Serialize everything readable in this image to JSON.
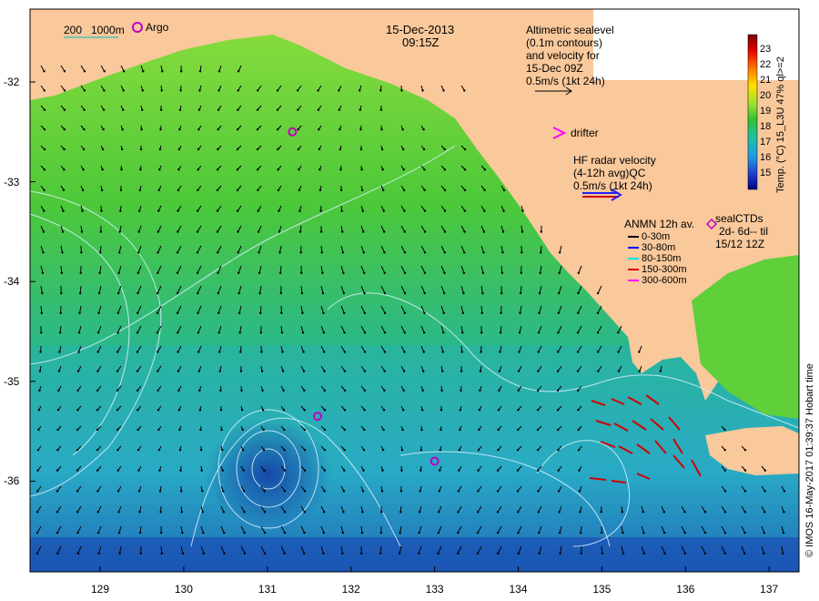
{
  "header": {
    "date": "15-Dec-2013",
    "time": "09:15Z"
  },
  "scale_bar": {
    "labels": [
      "200",
      "1000m"
    ]
  },
  "argo": {
    "label": "Argo"
  },
  "altimetry": {
    "lines": [
      "Altimetric sealevel",
      "(0.1m contours)",
      "and velocity for",
      "15-Dec 09Z",
      "0.5m/s (1kt 24h)"
    ]
  },
  "drifter": {
    "label": "drifter"
  },
  "hf_radar": {
    "lines": [
      "HF radar velocity",
      "(4-12h avg)QC",
      "0.5m/s (1kt 24h)"
    ]
  },
  "anmn": {
    "title": "ANMN 12h av.",
    "entries": [
      {
        "label": "0-30m",
        "color": "#000000"
      },
      {
        "label": "30-80m",
        "color": "#0000ff"
      },
      {
        "label": "80-150m",
        "color": "#00e0e0"
      },
      {
        "label": "150-300m",
        "color": "#d00000"
      },
      {
        "label": "300-600m",
        "color": "#ff00ff"
      }
    ]
  },
  "seal": {
    "lines": [
      "sealCTDs",
      "2d- 6d-- til",
      "15/12 12Z"
    ]
  },
  "colorbar": {
    "ticks": [
      "23",
      "22",
      "21",
      "20",
      "19",
      "18",
      "17",
      "16",
      "15"
    ],
    "title": "Temp. (°C) 15_L3U 47% ql>=2"
  },
  "credit": "© IMOS 16-May-2017 01:39:37 Hobart time",
  "axes": {
    "y_ticks": [
      "-32",
      "-33",
      "-34",
      "-35",
      "-36"
    ],
    "x_ticks": [
      "129",
      "130",
      "131",
      "132",
      "133",
      "134",
      "135",
      "136",
      "137"
    ]
  },
  "colors": {
    "land": "#f9c89b",
    "ocean_warm": "#5fcf3a",
    "ocean_cool": "#2fb8c8",
    "ocean_cold": "#1030a0"
  },
  "argo_floats": [
    {
      "lon": 131.3,
      "lat": -32.5
    },
    {
      "lon": 131.6,
      "lat": -35.35
    },
    {
      "lon": 133.0,
      "lat": -35.8
    }
  ]
}
